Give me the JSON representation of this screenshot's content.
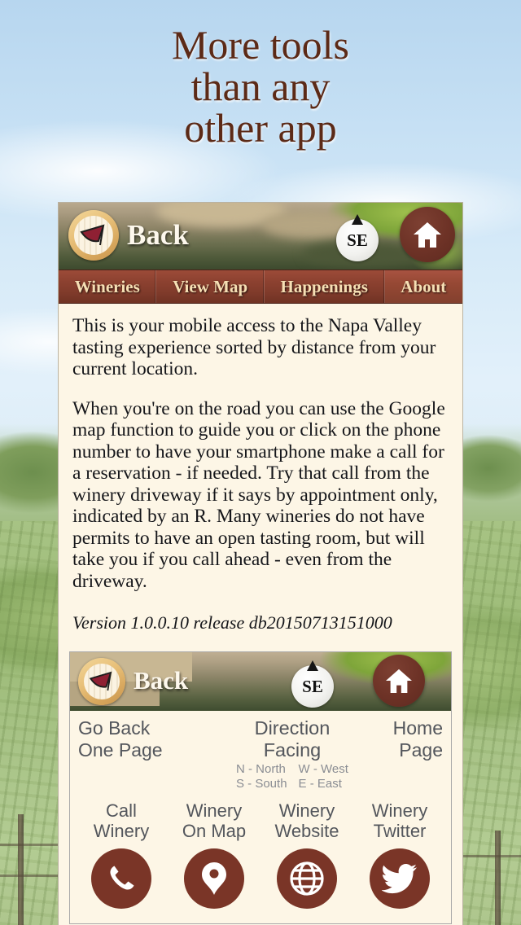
{
  "promo": {
    "headline_line1": "More tools",
    "headline_line2": "than any",
    "headline_line3": "other app"
  },
  "colors": {
    "brand_brown": "#7a3527",
    "nav_red": "#8c4130",
    "cream": "#fdf6e6",
    "tab_text": "#f6dfb4",
    "headline": "#5c2a17"
  },
  "app": {
    "header": {
      "logo_name": "wine-barrel-logo",
      "back_label": "Back",
      "compass_direction": "SE",
      "home_icon": "home-icon"
    },
    "tabs": [
      {
        "label": "Wineries",
        "active": false
      },
      {
        "label": "View Map",
        "active": false
      },
      {
        "label": "Happenings",
        "active": false
      },
      {
        "label": "About",
        "active": true
      }
    ],
    "content": {
      "paragraph1": "This is your mobile access to the Napa Valley tasting experience sorted by distance from your current location.",
      "paragraph2": "When you're on the road you can use the Google map function to guide you or click on the phone number to have your smartphone make a call for a reservation - if needed. Try that call from the winery driveway if it says by appointment only, indicated by an R. Many wineries do not have permits to have an open tasting room, but will take you if you call ahead - even from the driveway.",
      "version": "Version 1.0.0.10 release db20150713151000"
    },
    "legend": {
      "header": {
        "logo_name": "wine-barrel-logo",
        "back_label": "Back",
        "compass_direction": "SE",
        "home_icon": "home-icon"
      },
      "back_caption": "Go Back\nOne Page",
      "direction_title": "Direction Facing",
      "direction_key_col1_line1": "N - North",
      "direction_key_col1_line2": "S - South",
      "direction_key_col2_line1": "W - West",
      "direction_key_col2_line2": "E - East",
      "home_caption": "Home\nPage",
      "actions": [
        {
          "label": "Call\nWinery",
          "icon": "phone-icon"
        },
        {
          "label": "Winery\nOn Map",
          "icon": "map-pin-icon"
        },
        {
          "label": "Winery\nWebsite",
          "icon": "globe-icon"
        },
        {
          "label": "Winery\nTwitter",
          "icon": "twitter-bird-icon"
        }
      ]
    }
  }
}
